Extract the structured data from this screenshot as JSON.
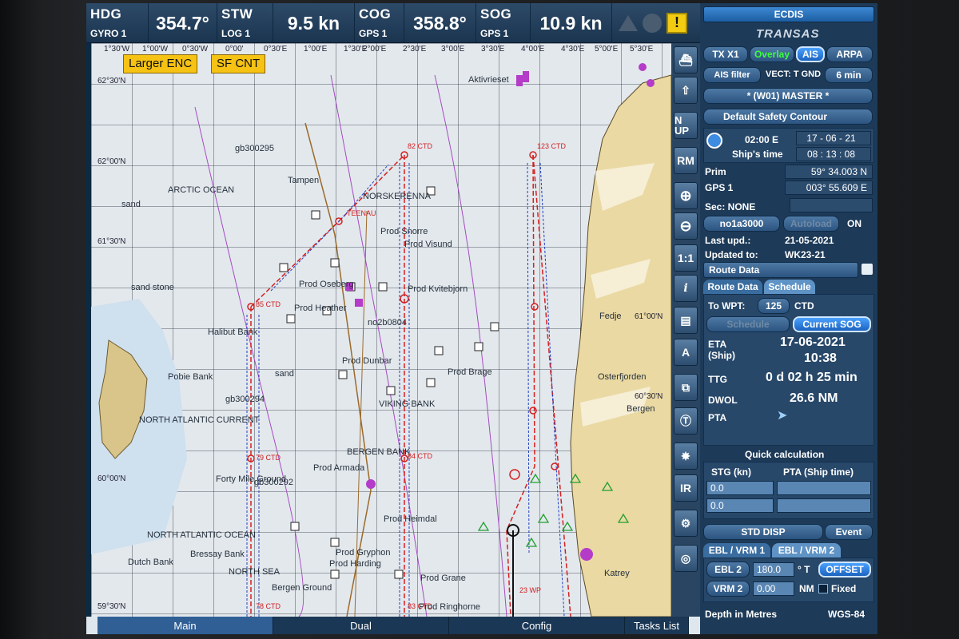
{
  "top_bar": {
    "hdg": {
      "label": "HDG",
      "sub": "GYRO 1",
      "value": "354.7°"
    },
    "stw": {
      "label": "STW",
      "sub": "LOG 1",
      "value": "9.5 kn"
    },
    "cog": {
      "label": "COG",
      "sub": "GPS 1",
      "value": "358.8°"
    },
    "sog": {
      "label": "SOG",
      "sub": "GPS 1",
      "value": "10.9 kn"
    },
    "alarm_icon": "warning-icon",
    "alarm_text": "!"
  },
  "chart": {
    "larger_enc": "Larger ENC",
    "sf_cnt": "SF CNT",
    "latitudes": [
      "62°30'N",
      "62°00'N",
      "61°30'N",
      "61°00'N",
      "60°30'N",
      "60°00'N",
      "59°30'N"
    ],
    "longitudes": [
      "1°30'W",
      "1°00'W",
      "0°30'W",
      "0°00'",
      "0°30'E",
      "1°00'E",
      "1°30'E",
      "2°00'E",
      "2°30'E",
      "3°00'E",
      "3°30'E",
      "4°00'E",
      "4°30'E",
      "5°00'E",
      "5°30'E"
    ],
    "place_labels": [
      "ARCTIC OCEAN",
      "sand",
      "Tampen",
      "NORSKERENNA",
      "Prod Snorre",
      "Prod Visund",
      "Prod Kvitebjorn",
      "Prod Oseberg",
      "Prod Heather",
      "Halibut Bank",
      "Prod Brage",
      "Prod Dunbar",
      "sand",
      "VIKING BANK",
      "Pobie Bank",
      "NORTH ATLANTIC CURRENT",
      "BERGEN BANK",
      "Prod Armada",
      "Prod Heimdal",
      "NORTH ATLANTIC OCEAN",
      "Bressay Bank",
      "NORTH SEA",
      "Dutch Bank",
      "Bergen Ground",
      "Aktivrieset",
      "Fedje",
      "Bergen",
      "Osterfjorden",
      "sand stone",
      "Prod Gryphon",
      "gb300295",
      "gb300294",
      "gb300292",
      "no2b0804",
      "Forty Mile Ground",
      "Prod Grane",
      "Prod Harding",
      "Katrey"
    ],
    "route_labels": [
      "82 CTD",
      "123 CTD",
      "85 CTD",
      "84 CTD",
      "79 CTD",
      "78 CTD",
      "83 CTD",
      "23 WP",
      "TEENAU",
      "Prod Ringhorne"
    ]
  },
  "toolbar": {
    "buttons": [
      "N UP",
      "RM",
      "1:1",
      "i",
      "IR"
    ]
  },
  "bottom_bar": {
    "tabs": [
      "Main",
      "Dual",
      "Config",
      "Tasks List"
    ]
  },
  "panel": {
    "title": "ECDIS",
    "brand": "TRANSAS",
    "tx": "TX X1",
    "overlay": "Overlay",
    "ais": "AIS",
    "arpa": "ARPA",
    "ais_filter": "AIS filter",
    "vect": "VECT: T GND",
    "vect_time": "6 min",
    "master": "* (W01) MASTER *",
    "safety": "Default Safety Contour",
    "tz": "02:00 E",
    "date": "17 - 06 - 21",
    "ships_time_lbl": "Ship's time",
    "ships_time": "08 : 13 : 08",
    "prim_lbl": "Prim",
    "prim_val": "59° 34.003 N",
    "gps_lbl": "GPS 1",
    "gps_val": "003° 55.609 E",
    "sec": "Sec: NONE",
    "chart_set": "no1a3000",
    "autoload": "Autoload",
    "on": "ON",
    "last_upd_lbl": "Last upd.:",
    "last_upd": "21-05-2021",
    "updated_to_lbl": "Updated to:",
    "updated_to": "WK23-21",
    "route_data_sel": "Route Data",
    "tab_route": "Route Data",
    "tab_schedule": "Schedule",
    "to_wpt_lbl": "To WPT:",
    "to_wpt": "125",
    "to_wpt_type": "CTD",
    "schedule_btn": "Schedule",
    "current_sog": "Current SOG",
    "eta_lbl": "ETA (Ship)",
    "eta_date": "17-06-2021",
    "eta_time": "10:38",
    "ttg_lbl": "TTG",
    "ttg": "0 d 02 h 25 min",
    "dwol_lbl": "DWOL",
    "dwol": "26.6 NM",
    "pta_lbl": "PTA",
    "quick_calc": "Quick calculation",
    "stg_hdr": "STG (kn)",
    "pta_hdr": "PTA (Ship time)",
    "stg_rows": [
      "0.0",
      "0.0"
    ],
    "std_disp": "STD DISP",
    "event": "Event",
    "ebl_tab1": "EBL / VRM 1",
    "ebl_tab2": "EBL / VRM 2",
    "ebl_lbl": "EBL 2",
    "ebl_val": "180.0",
    "ebl_unit": "° T",
    "offset": "OFFSET",
    "vrm_lbl": "VRM 2",
    "vrm_val": "0.00",
    "vrm_unit": "NM",
    "fixed": "Fixed",
    "depth": "Depth in Metres",
    "datum": "WGS-84"
  }
}
